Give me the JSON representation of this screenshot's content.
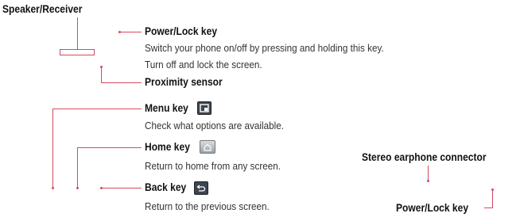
{
  "labels": {
    "speaker_receiver": "Speaker/Receiver",
    "power_lock_key_top": "Power/Lock key",
    "power_lock_desc_1": "Switch your phone on/off by pressing and holding this key.",
    "power_lock_desc_2": "Turn off and lock the screen.",
    "proximity_sensor": "Proximity sensor",
    "menu_key": "Menu key",
    "menu_key_desc": "Check what options are available.",
    "home_key": "Home key",
    "home_key_desc": "Return to home from any screen.",
    "back_key": "Back key",
    "back_key_desc": "Return to the previous screen.",
    "stereo_earphone_connector": "Stereo earphone connector",
    "power_lock_key_bottom": "Power/Lock key"
  },
  "icons": {
    "menu": "menu-icon",
    "home": "home-icon",
    "back": "back-icon"
  },
  "colors": {
    "leader_line": "#d44a5f",
    "text": "#111111"
  }
}
